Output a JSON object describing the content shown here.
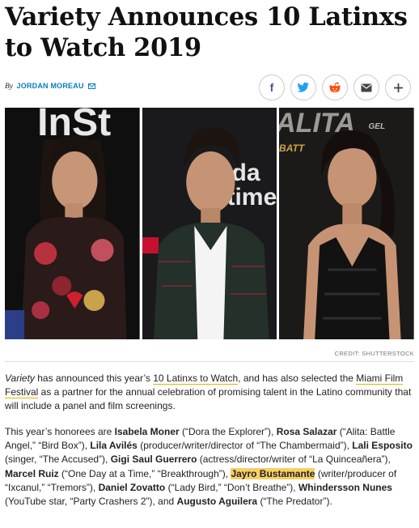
{
  "article": {
    "headline": "Variety Announces 10 Latinxs to Watch 2019",
    "byline_prefix": "By",
    "author": "JORDAN MOREAU",
    "image_credit": "CREDIT: SHUTTERSTOCK"
  },
  "share": [
    {
      "name": "facebook-share-button",
      "icon": "facebook-icon",
      "glyph": "f",
      "color": "#3b5998"
    },
    {
      "name": "twitter-share-button",
      "icon": "twitter-icon",
      "color": "#1da1f2"
    },
    {
      "name": "reddit-share-button",
      "icon": "reddit-icon",
      "color": "#ff4500"
    },
    {
      "name": "email-share-button",
      "icon": "email-icon",
      "color": "#444444"
    },
    {
      "name": "more-share-button",
      "icon": "plus-icon",
      "glyph": "+",
      "color": "#444444"
    }
  ],
  "colors": {
    "link_underline": "#e6b400",
    "highlight": "#f7cf66",
    "author": "#0a7cc1"
  },
  "photos": [
    {
      "name": "photo-isabela-moner",
      "backdrop": "InStyle step-and-repeat"
    },
    {
      "name": "photo-marcel-ruiz",
      "backdrop": "Netflix step-and-repeat"
    },
    {
      "name": "photo-rosa-salazar",
      "backdrop": "Alita premiere"
    }
  ],
  "backdrop_text": {
    "left": "InSt",
    "middle_top": "da",
    "middle_bottom": "time",
    "right_top": "ALITA",
    "right_sub": "BATT",
    "right_sub2": "GEL"
  },
  "paragraph1": {
    "s1": "Variety",
    "s2": " has announced this year’s ",
    "link1": "10 Latinxs to Watch",
    "s3": ", and has also selected the ",
    "link2": "Miami Film Festival",
    "s4": " as a partner for the annual celebration of promising talent in the Latino community that will include a panel and film screenings."
  },
  "paragraph2": {
    "t1": "This year’s honorees are ",
    "n1": "Isabela Moner",
    "t2": " (“Dora the Explorer”), ",
    "n2": "Rosa Salazar",
    "t3": " (“Alita: Battle Angel,” “Bird Box”), ",
    "n3": "Lila Avilés",
    "t4": " (producer/writer/director of “The Chambermaid”), ",
    "n4": "Lali Esposito",
    "t5": " (singer, “The Accused”), ",
    "n5": "Gigi Saul Guerrero",
    "t6": " (actress/director/writer of “La Quinceañera”), ",
    "n6": "Marcel Ruiz",
    "t7": " (“One Day at a Time,” “Breakthrough”), ",
    "n7": "Jayro Bustamante",
    "t8": " (writer/producer of “Ixcanul,” “Tremors”), ",
    "n8": "Daniel Zovatto",
    "t9": " (“Lady Bird,” “Don’t Breathe”), ",
    "n9": "Whindersson Nunes",
    "t10": " (YouTube star, “Party Crashers 2”), and ",
    "n10": "Augusto Aguilera",
    "t11": " (“The Predator”)."
  }
}
